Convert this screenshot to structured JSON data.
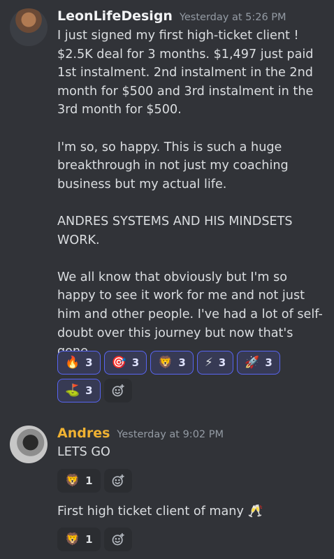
{
  "messages": [
    {
      "author": "LeonLifeDesign",
      "timestamp": "Yesterday at 5:26 PM",
      "paragraphs": [
        "I just signed my first high-ticket client ! $2.5K deal for 3 months. $1,497 just paid 1st instalment. 2nd instalment in the 2nd month for $500 and 3rd instalment in the 3rd month for $500.",
        "I'm so, so happy. This is such a huge breakthrough in not just my coaching business but my actual life.",
        "ANDRES SYSTEMS AND HIS MINDSETS WORK.",
        "We all know that obviously but I'm so happy to see it work for me and not just him and other people. I've had a lot of self-doubt over this journey but now that's gone."
      ],
      "reactions": [
        {
          "emoji": "🔥",
          "icon": "fire-emoji",
          "count": "3"
        },
        {
          "emoji": "🎯",
          "icon": "dart-emoji",
          "count": "3"
        },
        {
          "emoji": "🦁",
          "icon": "lion-emoji",
          "count": "3"
        },
        {
          "emoji": "⚡",
          "icon": "lightning-emoji",
          "count": "3"
        },
        {
          "emoji": "🚀",
          "icon": "rocket-emoji",
          "count": "3"
        },
        {
          "emoji": "⛳",
          "icon": "golf-flag-emoji",
          "count": "3"
        }
      ]
    },
    {
      "author": "Andres",
      "timestamp": "Yesterday at 9:02 PM",
      "text1": "LETS GO",
      "reaction1": {
        "emoji": "🦁",
        "icon": "lion-emoji",
        "count": "1"
      },
      "text2": "First high ticket client of many 🥂",
      "reaction2": {
        "emoji": "🦁",
        "icon": "lion-emoji",
        "count": "1"
      }
    }
  ],
  "colors": {
    "background": "#313338",
    "accent": "#5865f2",
    "author2": "#f0b232"
  }
}
